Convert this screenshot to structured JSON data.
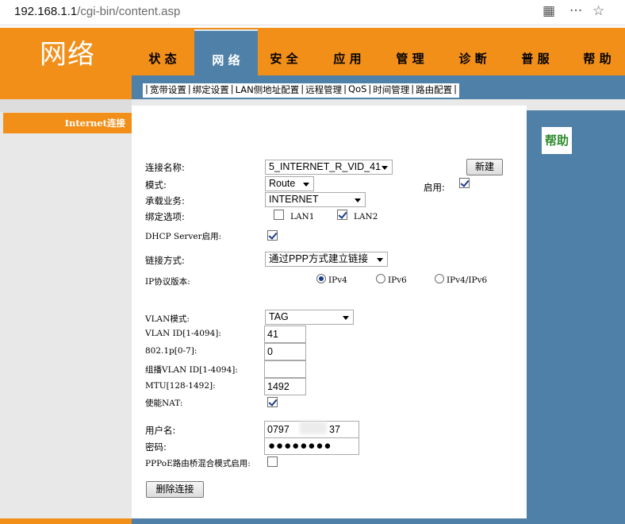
{
  "browser": {
    "url_host": "192.168.1.1",
    "url_path": "/cgi-bin/content.asp"
  },
  "header": {
    "logo": "网络",
    "tabs": [
      {
        "label": "状 态"
      },
      {
        "label": "网 络",
        "active": true
      },
      {
        "label": "安 全"
      },
      {
        "label": "应 用"
      },
      {
        "label": "管 理"
      },
      {
        "label": "诊 断"
      },
      {
        "label": "普 服"
      },
      {
        "label": "帮 助"
      }
    ],
    "subnav": [
      "宽带设置",
      "绑定设置",
      "LAN侧地址配置",
      "远程管理",
      "QoS",
      "时间管理",
      "路由配置"
    ]
  },
  "sidebar": {
    "item": "Internet连接"
  },
  "help": {
    "label": "帮助"
  },
  "form": {
    "conn_name_label": "连接名称:",
    "conn_name_value": "5_INTERNET_R_VID_41",
    "new_button": "新建",
    "mode_label": "模式:",
    "mode_value": "Route",
    "enable_label": "启用:",
    "enable_checked": true,
    "service_label": "承载业务:",
    "service_value": "INTERNET",
    "bind_label": "绑定选项:",
    "lan1_label": "LAN1",
    "lan1_checked": false,
    "lan2_label": "LAN2",
    "lan2_checked": true,
    "dhcp_label": "DHCP Server启用:",
    "dhcp_checked": true,
    "link_label": "链接方式:",
    "link_value": "通过PPP方式建立链接",
    "ip_label": "IP协议版本:",
    "ip_options": [
      "IPv4",
      "IPv6",
      "IPv4/IPv6"
    ],
    "ip_selected": "IPv4",
    "vlan_mode_label": "VLAN模式:",
    "vlan_mode_value": "TAG",
    "vlan_id_label": "VLAN ID[1-4094]:",
    "vlan_id_value": "41",
    "p8021_label": "802.1p[0-7]:",
    "p8021_value": "0",
    "mcast_vlan_label": "组播VLAN ID[1-4094]:",
    "mcast_vlan_value": "",
    "mtu_label": "MTU[128-1492]:",
    "mtu_value": "1492",
    "nat_label": "使能NAT:",
    "nat_checked": true,
    "user_label": "用户名:",
    "user_value": "0797",
    "user_value_tail": "37",
    "pwd_label": "密码:",
    "pwd_value": "●●●●●●●●",
    "pppoe_label": "PPPoE路由桥混合模式启用:",
    "pppoe_checked": false,
    "delete_button": "删除连接"
  }
}
